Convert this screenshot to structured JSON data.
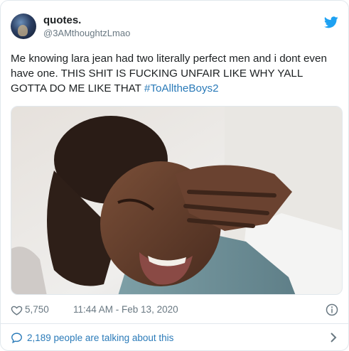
{
  "tweet": {
    "display_name": "quotes.",
    "handle": "@3AMthoughtzLmao",
    "text_plain": "Me knowing lara jean had two literally perfect men and i dont even have one. THIS SHIT IS FUCKING UNFAIR LIKE WHY YALL GOTTA DO ME LIKE THAT ",
    "hashtag": "#ToAlltheBoys2",
    "likes": "5,750",
    "timestamp": "11:44 AM - Feb 13, 2020",
    "talking_about": "2,189 people are talking about this"
  },
  "icons": {
    "brand": "twitter-bird-icon",
    "like": "heart-icon",
    "info": "info-icon",
    "conversation": "speech-bubble-icon",
    "more": "chevron-right-icon"
  },
  "colors": {
    "text": "#1c2022",
    "secondary": "#697882",
    "link": "#2b7bb9",
    "brand": "#1da1f2",
    "border": "#e1e8ed"
  }
}
